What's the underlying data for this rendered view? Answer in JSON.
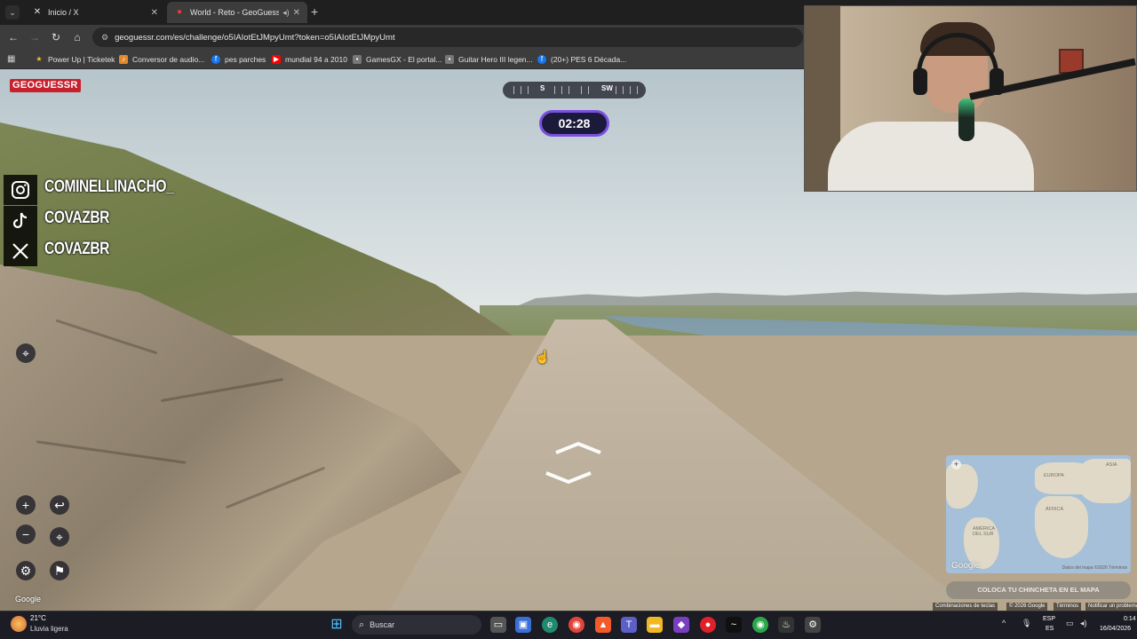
{
  "browser": {
    "tabs": [
      {
        "label": "Inicio / X",
        "icon": "x-logo-icon"
      },
      {
        "label": "World - Reto - GeoGuessr",
        "icon": "map-pin-icon"
      }
    ],
    "url": "geoguessr.com/es/challenge/o5IAIotEtJMpyUmt?token=o5IAIotEtJMpyUmt",
    "bookmarks": [
      {
        "label": "Power Up | Ticketek",
        "color": "#ffffff"
      },
      {
        "label": "Conversor de audio...",
        "color": "#e28a2b"
      },
      {
        "label": "pes parches",
        "color": "#1877f2"
      },
      {
        "label": "mundial 94 a 2010",
        "color": "#ff0000"
      },
      {
        "label": "GamesGX - El portal...",
        "color": "#888888"
      },
      {
        "label": "Guitar Hero III legen...",
        "color": "#888888"
      },
      {
        "label": "(20+) PES 6 Década...",
        "color": "#1877f2"
      }
    ]
  },
  "game": {
    "logo": "GEOGUESSR",
    "compass": {
      "labels": [
        "S",
        "SW"
      ]
    },
    "timer": "02:28",
    "minimap": {
      "labels": [
        "EUROPA",
        "ÁFRICA",
        "AMÉRICA DEL SUR",
        "ASIA"
      ],
      "google": "Google",
      "attribution": "Datos del mapa ©2026   Términos"
    },
    "guess_button": "COLOCA TU CHINCHETA EN EL MAPA",
    "google_watermark": "Google",
    "attribution": [
      "Combinaciones de teclas",
      "© 2026 Google",
      "Términos",
      "Notificar un problema"
    ]
  },
  "overlay": {
    "socials": [
      {
        "icon": "instagram-icon",
        "handle": "COMINELLINACHO_"
      },
      {
        "icon": "tiktok-icon",
        "handle": "COVAZBR"
      },
      {
        "icon": "x-logo-icon",
        "handle": "COVAZBR"
      }
    ]
  },
  "taskbar": {
    "weather_temp": "21°C",
    "weather_desc": "Lluvia ligera",
    "search": "Buscar",
    "lang_line1": "ESP",
    "lang_line2": "ES",
    "clock_time": "0:14",
    "clock_date": "16/04/2026"
  }
}
